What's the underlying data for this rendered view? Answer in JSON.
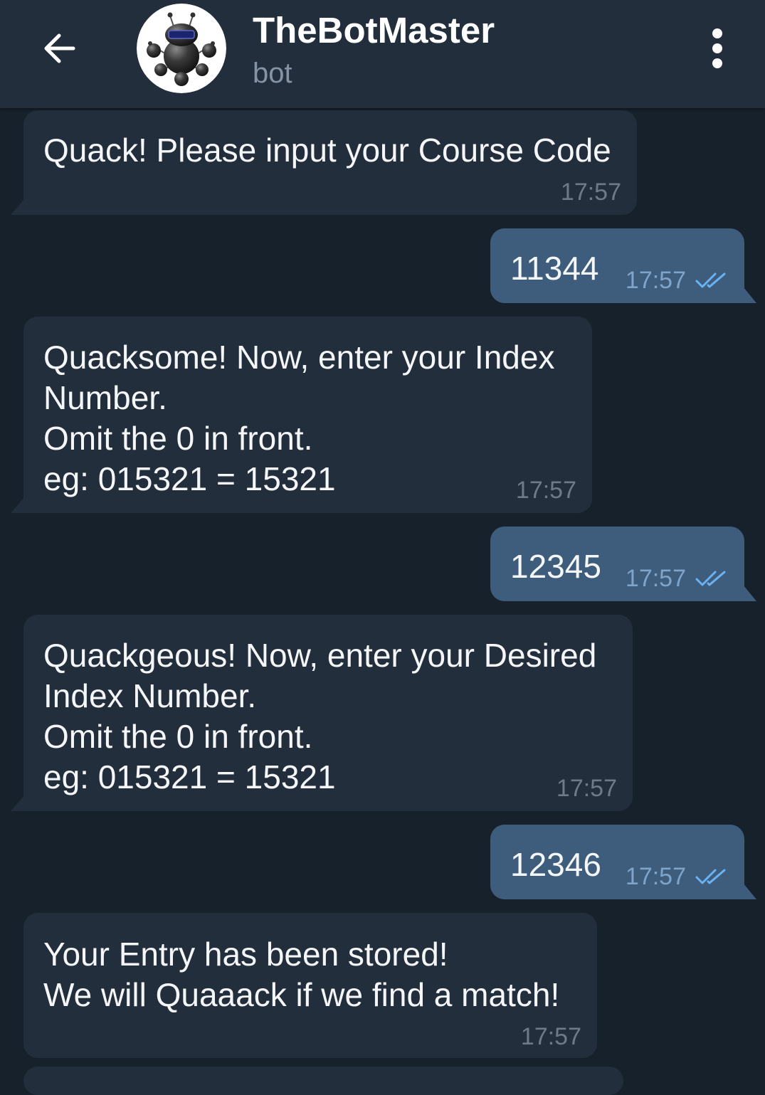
{
  "header": {
    "title": "TheBotMaster",
    "subtitle": "bot",
    "back_icon": "arrow-left-icon",
    "avatar_icon": "robot-avatar-icon",
    "menu_icon": "more-vertical-icon"
  },
  "messages": [
    {
      "lines": [
        "Quack! Please input your Course Code"
      ],
      "time": "17:57"
    },
    {
      "lines": [
        "11344"
      ],
      "time": "17:57",
      "status_icon": "double-check-icon"
    },
    {
      "lines": [
        "Quacksome! Now, enter your Index",
        "Number.",
        "Omit the 0 in front.",
        "eg: 015321 = 15321"
      ],
      "time": "17:57"
    },
    {
      "lines": [
        "12345"
      ],
      "time": "17:57",
      "status_icon": "double-check-icon"
    },
    {
      "lines": [
        "Quackgeous! Now, enter your Desired",
        "Index Number.",
        "Omit the 0 in front.",
        "eg: 015321 = 15321"
      ],
      "time": "17:57"
    },
    {
      "lines": [
        "12346"
      ],
      "time": "17:57",
      "status_icon": "double-check-icon"
    },
    {
      "lines": [
        "Your Entry has been stored!",
        "We will Quaaack if we find a match!"
      ],
      "time": "17:57"
    }
  ],
  "colors": {
    "header_bg": "#232e3c",
    "chat_bg": "#17212b",
    "incoming_bubble": "#232e3c",
    "outgoing_bubble": "#3e5c7c",
    "subtitle": "#8494a5",
    "incoming_time": "#6d7a87",
    "outgoing_time": "#7ea4c9",
    "check": "#6ab3f3"
  }
}
